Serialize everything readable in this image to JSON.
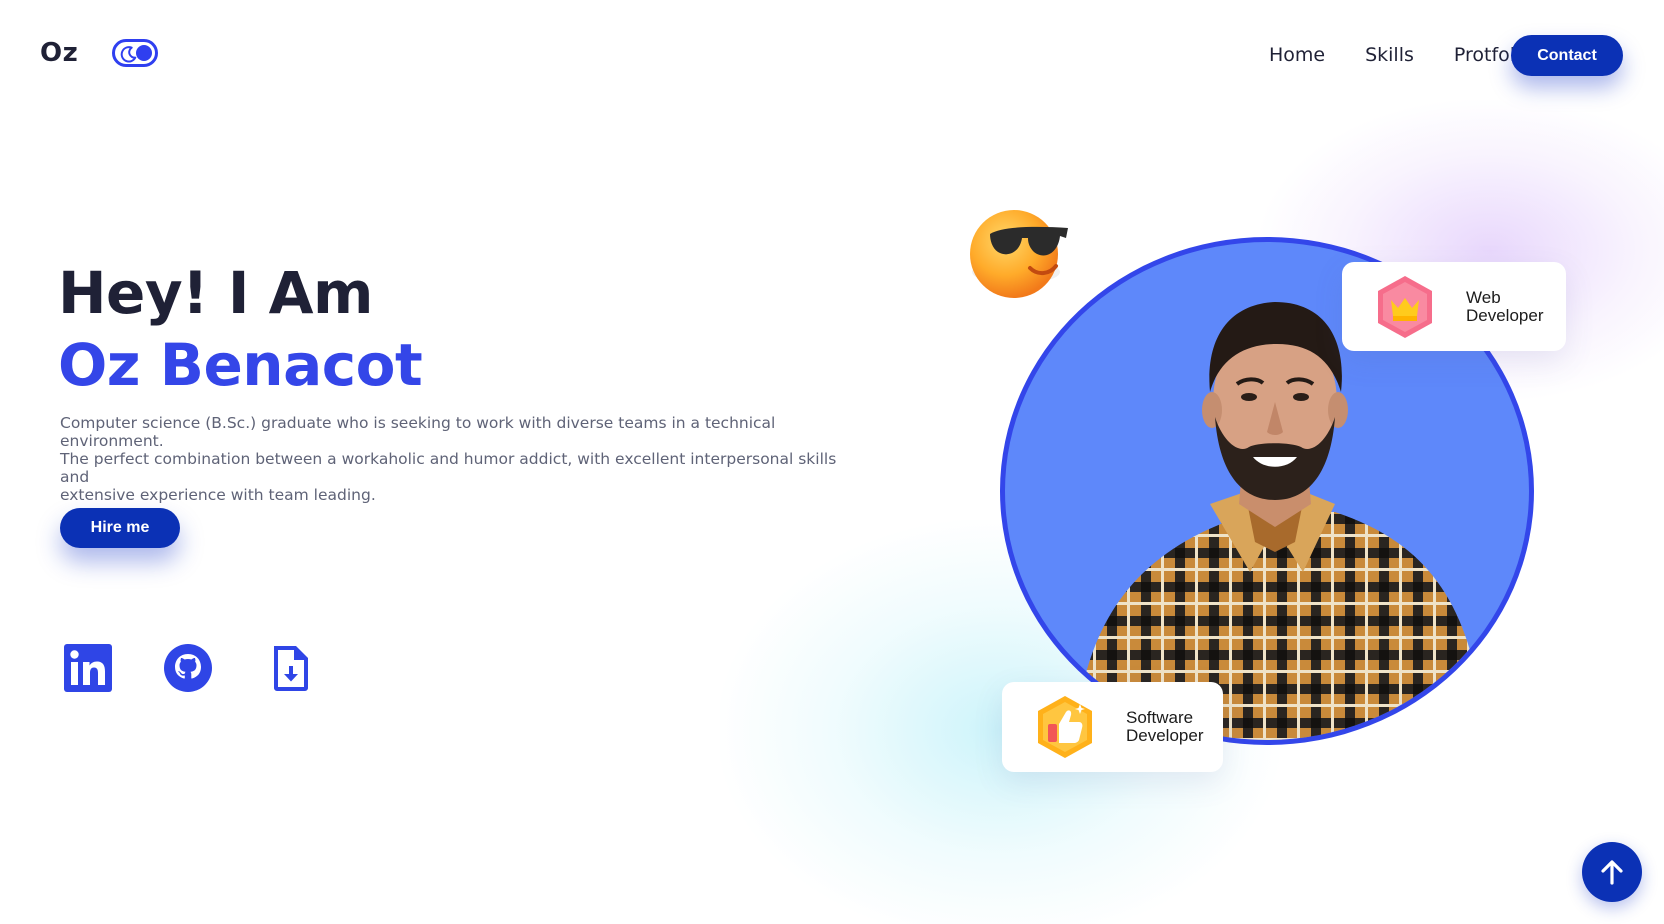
{
  "header": {
    "logo": "Oz",
    "theme_toggle_icon": "moon-icon",
    "nav": [
      "Home",
      "Skills",
      "Protfolio"
    ],
    "contact_label": "Contact"
  },
  "hero": {
    "greeting": "Hey! I Am",
    "name": "Oz Benacot",
    "bio_lines": [
      "Computer science (B.Sc.) graduate who is seeking to work with diverse teams in a technical environment.",
      "The perfect combination between a workaholic and humor addict, with excellent interpersonal skills and",
      "extensive experience with team leading."
    ],
    "hire_label": "Hire me",
    "social_icons": [
      "linkedin-icon",
      "github-icon",
      "resume-download-icon"
    ]
  },
  "badges": {
    "web": {
      "line1": "Web",
      "line2": "Developer",
      "icon": "crown-icon"
    },
    "software": {
      "line1": "Software",
      "line2": "Developer",
      "icon": "thumbs-up-icon"
    }
  },
  "decor": {
    "emoji": "sunglasses-emoji",
    "scroll_top_icon": "arrow-up-icon"
  },
  "colors": {
    "accent": "#3446e8",
    "button": "#0b31b5",
    "portrait_bg": "#5e88fa",
    "text_dark": "#1f2136"
  }
}
